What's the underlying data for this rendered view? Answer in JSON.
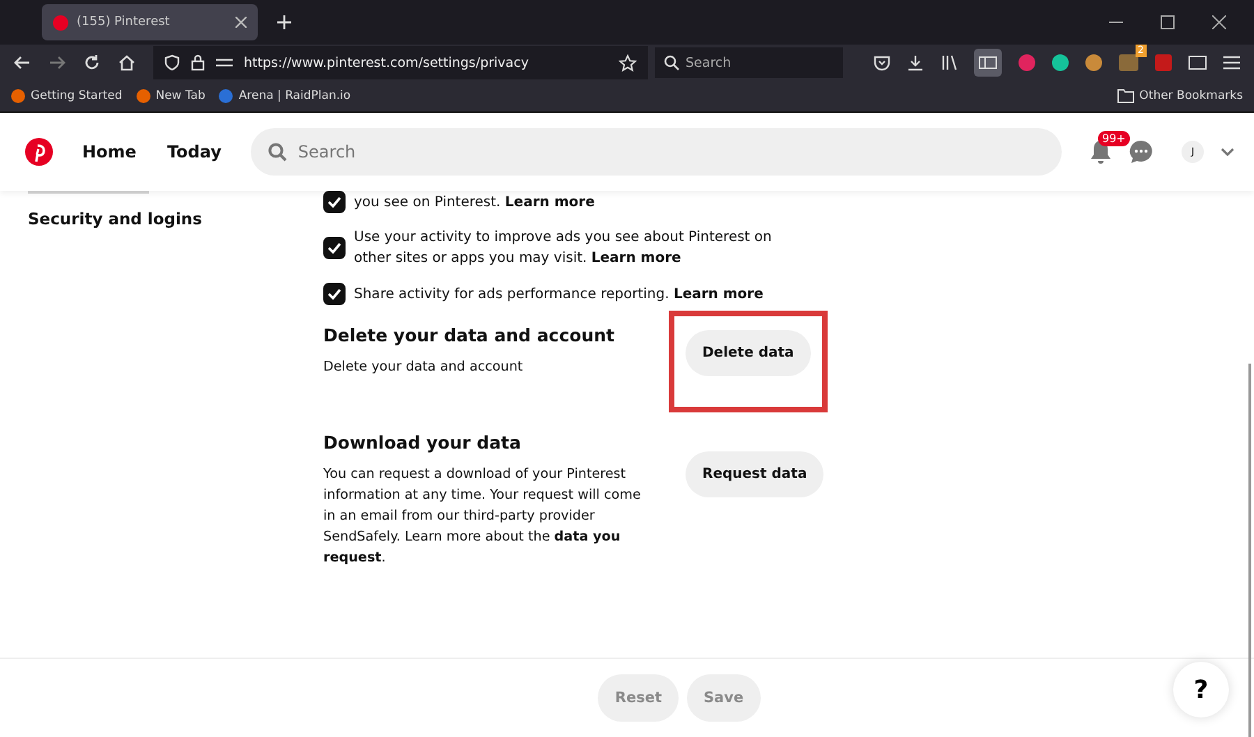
{
  "browser": {
    "tab": {
      "title": "(155) Pinterest",
      "selected": true
    },
    "url": "https://www.pinterest.com/settings/privacy",
    "search_placeholder": "Search",
    "extension_badge": "2",
    "bookmarks": [
      {
        "label": "Getting Started",
        "color": "#e66000"
      },
      {
        "label": "New Tab",
        "color": "#e66000"
      },
      {
        "label": "Arena | RaidPlan.io",
        "color": "#2a6fd6"
      }
    ],
    "other_bookmarks": "Other Bookmarks"
  },
  "header": {
    "nav": [
      {
        "label": "Home"
      },
      {
        "label": "Today"
      }
    ],
    "search_placeholder": "Search",
    "notification_badge": "99+",
    "avatar_initial": "J"
  },
  "sidebar": {
    "items": [
      {
        "label": "Security and logins"
      }
    ]
  },
  "settings": [
    {
      "text": "you see on Pinterest. **Learn more**",
      "checked": true
    },
    {
      "text": "Use your activity to improve ads you see about Pinterest on other sites or apps you may visit. **Learn more**",
      "checked": true
    },
    {
      "text": "Share activity for ads performance reporting. **Learn more**",
      "checked": true
    }
  ],
  "sections": [
    {
      "title": "Delete your data and account",
      "description": "Delete your data and account",
      "button": "Delete data",
      "highlighted": true
    },
    {
      "title": "Download your data",
      "description": "You can request a download of your Pinterest information at any time. Your request will come in an email from our third-party provider SendSafely. Learn more about the **data you request**.",
      "button": "Request data",
      "highlighted": false
    }
  ],
  "footer": {
    "buttons": [
      {
        "label": "Reset",
        "disabled": true
      },
      {
        "label": "Save",
        "disabled": true
      }
    ],
    "help": "?"
  }
}
